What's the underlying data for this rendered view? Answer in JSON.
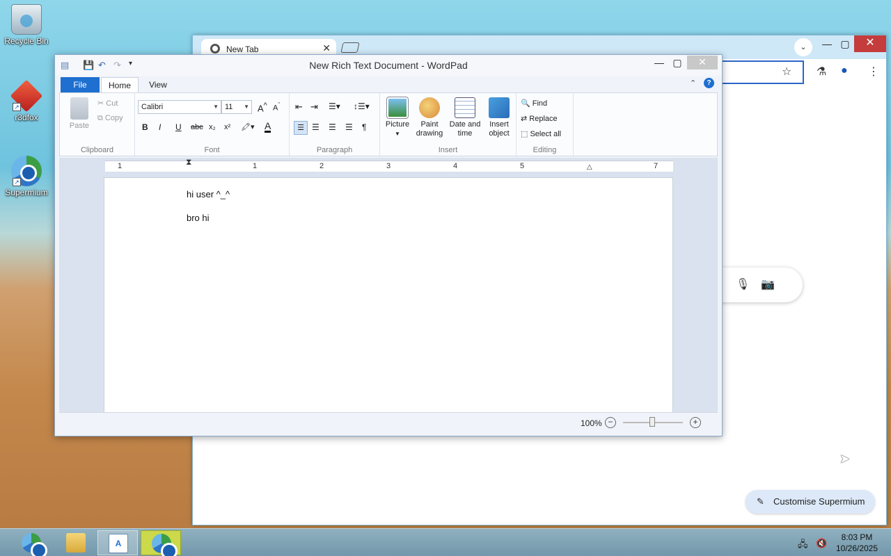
{
  "desktop": {
    "icons": [
      {
        "label": "Recycle Bin"
      },
      {
        "label": "r3dfox"
      },
      {
        "label": "Supermium"
      }
    ]
  },
  "browser": {
    "tab_title": "New Tab",
    "tab_close": "✕",
    "customise_label": "Customise Supermium"
  },
  "wordpad": {
    "title": "New Rich Text Document - WordPad",
    "tabs": {
      "file": "File",
      "home": "Home",
      "view": "View"
    },
    "clipboard": {
      "paste": "Paste",
      "cut": "Cut",
      "copy": "Copy",
      "group": "Clipboard"
    },
    "font": {
      "family": "Calibri",
      "size": "11",
      "group": "Font"
    },
    "paragraph": {
      "group": "Paragraph"
    },
    "insert": {
      "picture": "Picture",
      "paint_drawing": "Paint drawing",
      "date_time": "Date and time",
      "insert_object": "Insert object",
      "group": "Insert"
    },
    "editing": {
      "find": "Find",
      "replace": "Replace",
      "select_all": "Select all",
      "group": "Editing"
    },
    "ruler_numbers": [
      "1",
      "1",
      "2",
      "3",
      "4",
      "5",
      "7"
    ],
    "document": {
      "lines": [
        "hi user ^_^",
        "bro hi"
      ]
    },
    "zoom": "100%"
  },
  "taskbar": {
    "time": "8:03 PM",
    "date": "10/26/2025"
  },
  "colors": {
    "file_tab": "#1e6fd0",
    "close_red": "#c43c3c",
    "taskbar_active": "#cbd94b"
  }
}
